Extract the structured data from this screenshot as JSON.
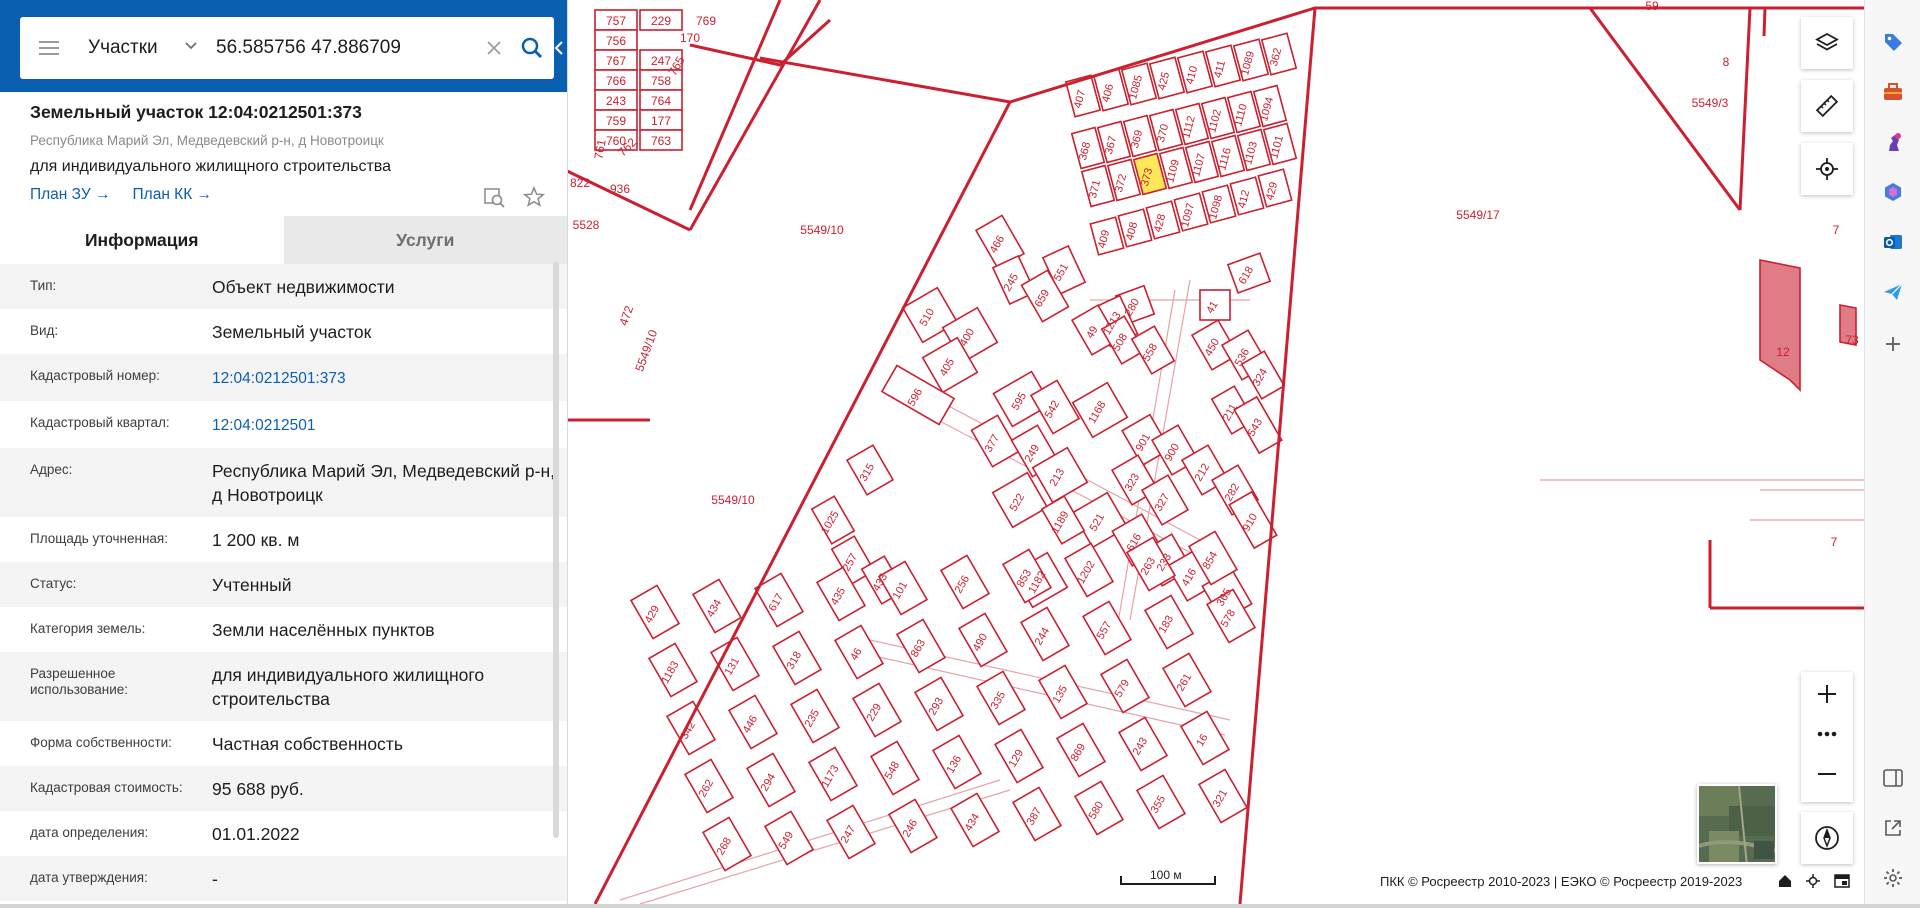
{
  "search": {
    "layer": "Участки",
    "query": "56.585756 47.886709"
  },
  "parcel": {
    "title": "Земельный участок 12:04:0212501:373",
    "address": "Республика Марий Эл, Медведевский р-н, д Новотроицк",
    "use": "для индивидуального жилищного строительства",
    "plan_zu": "План ЗУ →",
    "plan_kk": "План КК →"
  },
  "tabs": [
    {
      "label": "Информация"
    },
    {
      "label": "Услуги"
    }
  ],
  "info": [
    {
      "label": "Тип:",
      "value": "Объект недвижимости",
      "link": false
    },
    {
      "label": "Вид:",
      "value": "Земельный участок",
      "link": false
    },
    {
      "label": "Кадастровый номер:",
      "value": "12:04:0212501:373",
      "link": true
    },
    {
      "label": "Кадастровый квартал:",
      "value": "12:04:0212501",
      "link": true
    },
    {
      "label": "Адрес:",
      "value": "Республика Марий Эл, Медведевский р-н, д Новотроицк",
      "link": false
    },
    {
      "label": "Площадь уточненная:",
      "value": "1 200 кв. м",
      "link": false
    },
    {
      "label": "Статус:",
      "value": "Учтенный",
      "link": false
    },
    {
      "label": "Категория земель:",
      "value": "Земли населённых пунктов",
      "link": false
    },
    {
      "label": "Разрешенное использование:",
      "value": "для индивидуального жилищного строительства",
      "link": false
    },
    {
      "label": "Форма собственности:",
      "value": "Частная собственность",
      "link": false
    },
    {
      "label": "Кадастровая стоимость:",
      "value": "95 688 руб.",
      "link": false
    },
    {
      "label": "дата определения:",
      "value": "01.01.2022",
      "link": false
    },
    {
      "label": "дата утверждения:",
      "value": "-",
      "link": false
    }
  ],
  "map": {
    "scale_label": "100 м",
    "attribution": "ПКК © Росреестр 2010-2023 | ЕЭКО © Росреестр 2019-2023",
    "region_labels": [
      "5549/10",
      "5549/10",
      "5549/10",
      "5549/17",
      "5549/3",
      "5528",
      "12",
      "7",
      "7",
      "8",
      "59",
      "73",
      "822",
      "936",
      "472"
    ],
    "parcel_labels": [
      "757",
      "229",
      "769",
      "756",
      "767",
      "247",
      "170",
      "766",
      "758",
      "765",
      "243",
      "764",
      "759",
      "177",
      "760",
      "763",
      "761",
      "762",
      "407",
      "406",
      "1085",
      "425",
      "410",
      "411",
      "1089",
      "362",
      "368",
      "367",
      "369",
      "370",
      "1112",
      "1102",
      "1110",
      "1094",
      "371",
      "372",
      "373",
      "1109",
      "1107",
      "1116",
      "1103",
      "1101",
      "409",
      "408",
      "428",
      "1097",
      "1098",
      "412",
      "429",
      "466",
      "551",
      "618",
      "41",
      "280",
      "245",
      "659",
      "1213",
      "49",
      "508",
      "558",
      "510",
      "400",
      "405",
      "450",
      "536",
      "324",
      "596",
      "595",
      "542",
      "1168",
      "211",
      "543",
      "377",
      "249",
      "213",
      "901",
      "900",
      "212",
      "282",
      "910",
      "323",
      "327",
      "315",
      "522",
      "521",
      "1025",
      "1189",
      "616",
      "233",
      "416",
      "365",
      "1182",
      "257",
      "433",
      "429",
      "434",
      "617",
      "435",
      "101",
      "256",
      "853",
      "1202",
      "263",
      "854",
      "1183",
      "131",
      "318",
      "46",
      "863",
      "490",
      "244",
      "557",
      "183",
      "578",
      "342",
      "446",
      "235",
      "229",
      "293",
      "335",
      "135",
      "579",
      "261",
      "262",
      "294",
      "1173",
      "548",
      "136",
      "129",
      "869",
      "243",
      "16",
      "268",
      "549",
      "247",
      "246",
      "434",
      "387",
      "580",
      "355",
      "321",
      "209",
      "76",
      "301",
      "356",
      "302",
      "342",
      "399",
      "253",
      "388",
      "382",
      "389",
      "390",
      "385",
      "446",
      "517",
      "518",
      "303",
      "401",
      "181",
      "364",
      "540",
      "57",
      "333",
      "857",
      "413",
      "392",
      "462",
      "1179",
      "368",
      "500",
      "516",
      "376",
      "284",
      "346",
      "337",
      "326",
      "330",
      "345",
      "299",
      "169",
      "515",
      "512",
      "461"
    ],
    "highlight_parcel": "373"
  },
  "colors": {
    "header_blue": "#0b5fb0",
    "parcel_red": "#cc1f2f",
    "highlight_yellow": "#ffe75a",
    "link_blue": "#0b5fb0"
  },
  "icons": {
    "menu": "hamburger-icon",
    "chevron": "chevron-down-icon",
    "clear": "close-icon",
    "search": "search-icon",
    "collapse": "chevron-left-icon",
    "preview": "preview-search-icon",
    "favorite": "star-icon",
    "layers": "layers-icon",
    "ruler": "ruler-icon",
    "locate": "crosshair-icon",
    "zoom_in": "plus-icon",
    "zoom_more": "more-dots-icon",
    "zoom_out": "minus-icon",
    "compass": "compass-icon",
    "home": "home-icon",
    "target": "target-icon",
    "screen": "screen-icon"
  }
}
